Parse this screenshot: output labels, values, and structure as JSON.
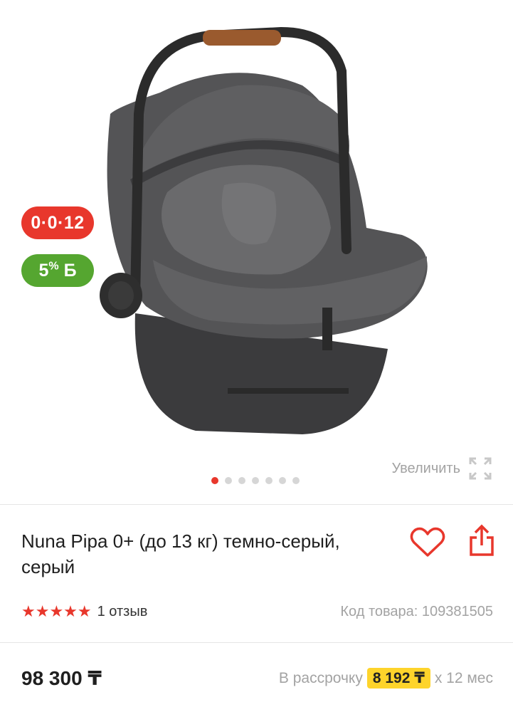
{
  "gallery": {
    "badges": {
      "installment": "0·0·12",
      "bonus_value": "5",
      "bonus_pct": "%",
      "bonus_currency": "Б"
    },
    "zoom_label": "Увеличить",
    "dots": {
      "total": 7,
      "active_index": 0
    }
  },
  "product": {
    "title": "Nuna Pipa 0+ (до 13 кг) темно-серый, серый",
    "stars": "★★★★★",
    "rating": 5,
    "reviews": "1 отзыв",
    "sku": "Код товара: 109381505",
    "price": "98 300 ₸",
    "installment": {
      "prefix": "В рассрочку",
      "amount": "8 192 ₸",
      "suffix": "x 12 мес"
    }
  },
  "icons": {
    "heart": "heart-icon",
    "share": "share-icon",
    "zoom": "expand-icon"
  },
  "colors": {
    "accent": "#e8372c",
    "bonus_green": "#55a630",
    "installment_highlight": "#fed42b",
    "muted_text": "#a3a3a3"
  }
}
